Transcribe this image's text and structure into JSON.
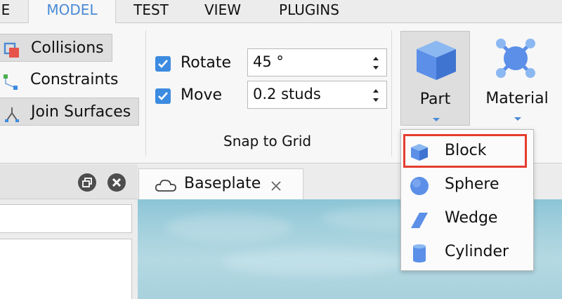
{
  "menu": {
    "tabs": [
      {
        "label": "E"
      },
      {
        "label": "MODEL"
      },
      {
        "label": "TEST"
      },
      {
        "label": "VIEW"
      },
      {
        "label": "PLUGINS"
      }
    ],
    "active_tab": "MODEL"
  },
  "ribbon": {
    "tools": {
      "collisions": "Collisions",
      "constraints": "Constraints",
      "join_surfaces": "Join Surfaces"
    },
    "snap": {
      "rotate_label": "Rotate",
      "rotate_value": "45 °",
      "rotate_checked": true,
      "move_label": "Move",
      "move_value": "0.2 studs",
      "move_checked": true,
      "group_title": "Snap to Grid"
    },
    "part_label": "Part",
    "material_label": "Material"
  },
  "part_dropdown": {
    "items": [
      {
        "label": "Block",
        "icon": "block-icon"
      },
      {
        "label": "Sphere",
        "icon": "sphere-icon"
      },
      {
        "label": "Wedge",
        "icon": "wedge-icon"
      },
      {
        "label": "Cylinder",
        "icon": "cylinder-icon"
      }
    ],
    "highlighted": "Block"
  },
  "document_tab": {
    "label": "Baseplate"
  },
  "colors": {
    "accent": "#4a8ad6",
    "checkbox": "#3c8be0",
    "highlight": "#e53d2f",
    "part_icon": "#5b8fe8"
  }
}
